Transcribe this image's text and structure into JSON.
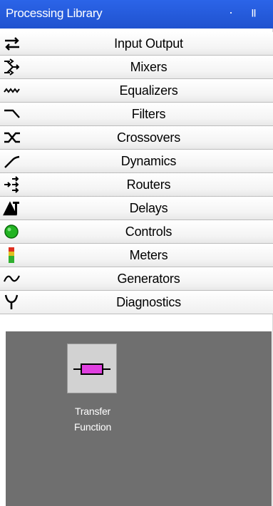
{
  "window": {
    "title": "Processing Library",
    "pin_icon": "pin-icon",
    "close_icon": "close-icon"
  },
  "categories": [
    {
      "label": "Input Output",
      "icon": "input-output-icon"
    },
    {
      "label": "Mixers",
      "icon": "mixers-icon"
    },
    {
      "label": "Equalizers",
      "icon": "equalizers-icon"
    },
    {
      "label": "Filters",
      "icon": "filters-icon"
    },
    {
      "label": "Crossovers",
      "icon": "crossovers-icon"
    },
    {
      "label": "Dynamics",
      "icon": "dynamics-icon"
    },
    {
      "label": "Routers",
      "icon": "routers-icon"
    },
    {
      "label": "Delays",
      "icon": "delays-icon"
    },
    {
      "label": "Controls",
      "icon": "controls-icon"
    },
    {
      "label": "Meters",
      "icon": "meters-icon"
    },
    {
      "label": "Generators",
      "icon": "generators-icon"
    },
    {
      "label": "Diagnostics",
      "icon": "diagnostics-icon"
    }
  ],
  "selected_category": "Diagnostics",
  "items": [
    {
      "label_line1": "Transfer",
      "label_line2": "Function",
      "icon": "transfer-function-icon"
    }
  ],
  "colors": {
    "titlebar": "#1f52cf",
    "content_bg": "#6f6f6f",
    "item_accent": "#e040e0"
  }
}
